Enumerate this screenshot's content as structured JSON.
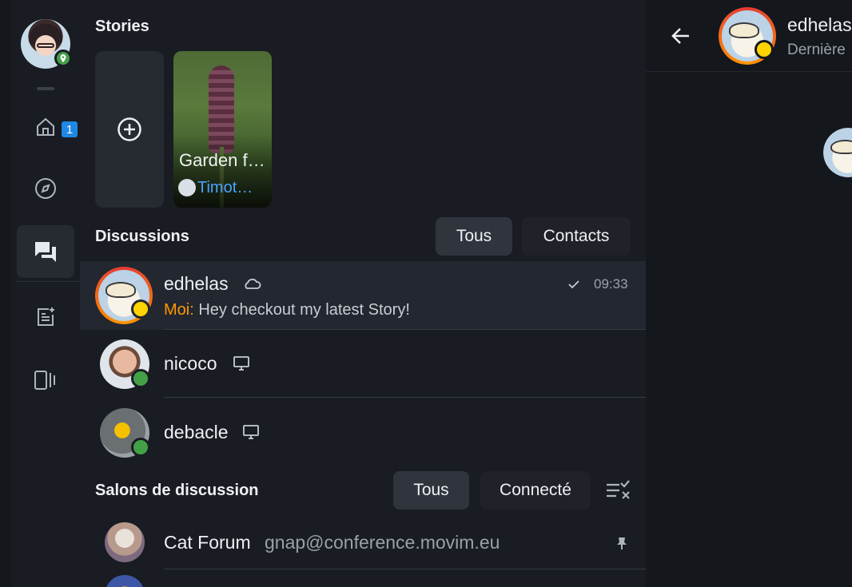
{
  "rail": {
    "home_badge": "1"
  },
  "stories": {
    "title": "Stories",
    "items": [
      {
        "title": "Garden f…",
        "author": "Timot…"
      }
    ]
  },
  "discussions": {
    "title": "Discussions",
    "filters": [
      "Tous",
      "Contacts"
    ],
    "selected_filter": "Tous",
    "items": [
      {
        "name": "edhelas",
        "prefix": "Moi:",
        "message": "Hey checkout my latest Story!",
        "time": "09:33",
        "status_icon": "cloud-icon",
        "read_icon": "check-icon"
      },
      {
        "name": "nicoco",
        "status_icon": "desktop-icon"
      },
      {
        "name": "debacle",
        "status_icon": "desktop-icon"
      }
    ]
  },
  "rooms": {
    "title": "Salons de discussion",
    "filters": [
      "Tous",
      "Connecté"
    ],
    "selected_filter": "Tous",
    "items": [
      {
        "name": "Cat Forum",
        "address": "gnap@conference.movim.eu",
        "pinned": true
      }
    ]
  },
  "chat_header": {
    "name": "edhelas",
    "subtitle": "Dernière"
  },
  "colors": {
    "accent": "#1e88e5",
    "online": "#43a047",
    "me_prefix": "#ff9800",
    "link": "#4aa3ff"
  }
}
